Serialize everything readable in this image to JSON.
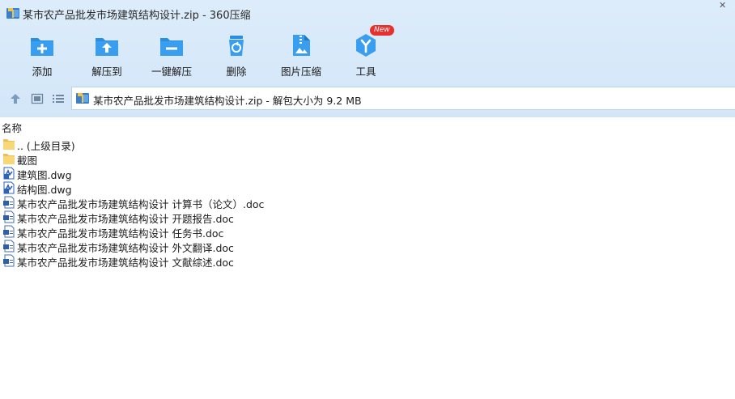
{
  "window": {
    "title": "某市农产品批发市场建筑结构设计.zip - 360压缩",
    "close_glyph": "✕"
  },
  "toolbar": {
    "items": [
      {
        "label": "添加",
        "icon": "add-icon"
      },
      {
        "label": "解压到",
        "icon": "extract-to-icon"
      },
      {
        "label": "一键解压",
        "icon": "one-click-extract-icon"
      },
      {
        "label": "删除",
        "icon": "delete-icon"
      },
      {
        "label": "图片压缩",
        "icon": "image-compress-icon"
      },
      {
        "label": "工具",
        "icon": "tools-icon",
        "badge": "New"
      }
    ]
  },
  "nav": {
    "path": "某市农产品批发市场建筑结构设计.zip - 解包大小为 9.2 MB"
  },
  "filelist": {
    "column_name": "名称",
    "items": [
      {
        "name": ".. (上级目录)",
        "type": "folder"
      },
      {
        "name": "截图",
        "type": "folder"
      },
      {
        "name": "建筑图.dwg",
        "type": "dwg"
      },
      {
        "name": "结构图.dwg",
        "type": "dwg"
      },
      {
        "name": "某市农产品批发市场建筑结构设计 计算书（论文）.doc",
        "type": "doc"
      },
      {
        "name": "某市农产品批发市场建筑结构设计 开题报告.doc",
        "type": "doc"
      },
      {
        "name": "某市农产品批发市场建筑结构设计 任务书.doc",
        "type": "doc"
      },
      {
        "name": "某市农产品批发市场建筑结构设计 外文翻译.doc",
        "type": "doc"
      },
      {
        "name": "某市农产品批发市场建筑结构设计 文献综述.doc",
        "type": "doc"
      }
    ]
  },
  "colors": {
    "toolbar_bg": "#d3e6f8",
    "icon_blue": "#2b8fe0",
    "badge_red": "#e8312f"
  }
}
